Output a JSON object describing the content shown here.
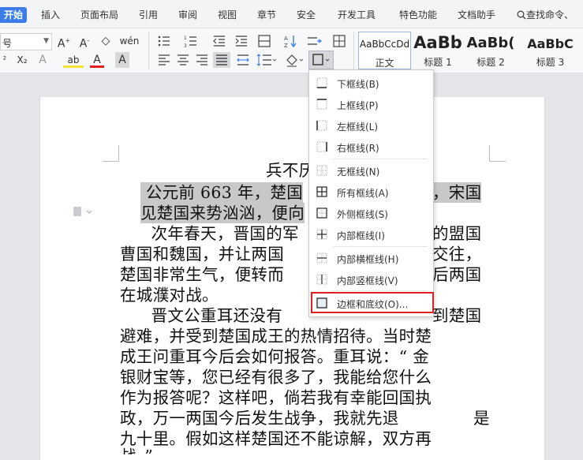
{
  "menu": {
    "tabs": [
      "开始",
      "插入",
      "页面布局",
      "引用",
      "审阅",
      "视图",
      "章节",
      "安全",
      "开发工具",
      "特色功能",
      "文档助手"
    ],
    "search_label": "查找命令、"
  },
  "ribbon": {
    "font_size_value": "号",
    "styles": [
      {
        "sample": "AaBbCcDd",
        "name": "正文"
      },
      {
        "sample": "AaBb",
        "name": "标题 1"
      },
      {
        "sample": "AaBb(",
        "name": "标题 2"
      },
      {
        "sample": "AaBbC",
        "name": "标题 3"
      }
    ]
  },
  "document": {
    "title_visible": "兵不厌",
    "lines": [
      {
        "text": " 公元前 663 年，楚国",
        "highlight": true
      },
      {
        "text": "，宋国",
        "highlight": true
      },
      {
        "text": "见楚国来势汹汹，便向",
        "highlight": true
      },
      {
        "text": "  次年春天，晋国的军",
        "highlight": false
      },
      {
        "text": "的盟国",
        "highlight": false
      },
      {
        "text": "曹国和魏国，并让两国",
        "highlight": false
      },
      {
        "text": "交往，",
        "highlight": false
      },
      {
        "text": "楚国非常生气，便转而",
        "highlight": false
      },
      {
        "text": "后两国",
        "highlight": false
      },
      {
        "text": "在城濮对战。",
        "highlight": false
      },
      {
        "text": "  晋文公重耳还没有",
        "highlight": false
      },
      {
        "text": "到楚国",
        "highlight": false
      },
      {
        "text": "避难，并受到楚国成王的热情招待。当时楚",
        "highlight": false
      },
      {
        "text": "成王问重耳今后会如何报答。重耳说：“ 金",
        "highlight": false
      },
      {
        "text": "银财宝等，您已经有很多了，我能给您什么",
        "highlight": false
      },
      {
        "text": "作为报答呢？这样吧，倘若我有幸能回国执",
        "highlight": false
      },
      {
        "text": "政，万一两国今后发生战争，我就先退",
        "highlight": false
      },
      {
        "text": "是",
        "highlight": false
      },
      {
        "text": "九十里。假如这样楚国还不能谅解，双方再",
        "highlight": false
      },
      {
        "text": "战。”",
        "highlight": false
      }
    ]
  },
  "dropdown": {
    "items": [
      {
        "label": "下框线(B)",
        "icon": "bottom-border-icon"
      },
      {
        "label": "上框线(P)",
        "icon": "top-border-icon"
      },
      {
        "label": "左框线(L)",
        "icon": "left-border-icon"
      },
      {
        "label": "右框线(R)",
        "icon": "right-border-icon"
      },
      {
        "label": "无框线(N)",
        "icon": "no-border-icon"
      },
      {
        "label": "所有框线(A)",
        "icon": "all-borders-icon"
      },
      {
        "label": "外侧框线(S)",
        "icon": "outside-borders-icon"
      },
      {
        "label": "内部框线(I)",
        "icon": "inside-borders-icon"
      },
      {
        "label": "内部横框线(H)",
        "icon": "inside-horizontal-border-icon"
      },
      {
        "label": "内部竖框线(V)",
        "icon": "inside-vertical-border-icon"
      },
      {
        "label": "边框和底纹(O)...",
        "icon": "borders-and-shading-icon"
      }
    ]
  },
  "colors": {
    "accent": "#3b7ce8",
    "callout": "#e02020",
    "highlight": "#c8c8c8"
  }
}
